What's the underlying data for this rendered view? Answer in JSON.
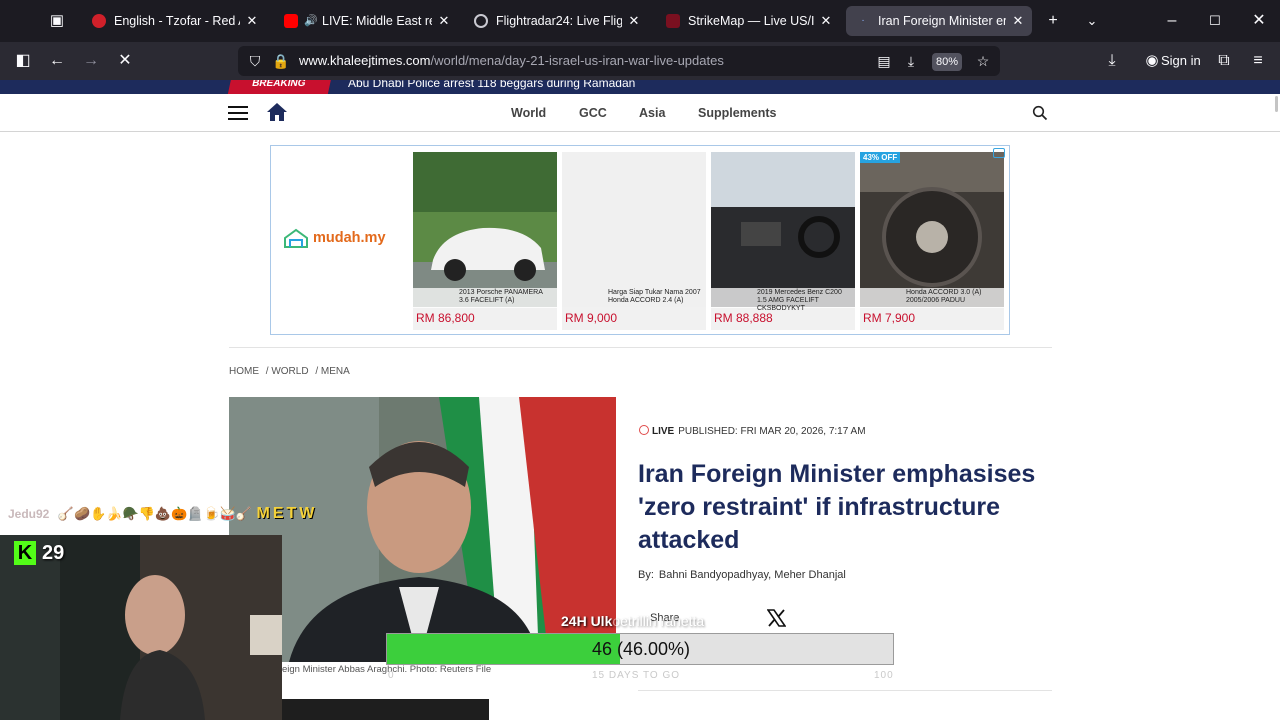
{
  "browser": {
    "tabs": [
      {
        "label": "English - Tzofar - Red Alert",
        "active": false
      },
      {
        "label": "LIVE: Middle East real-ti",
        "active": false
      },
      {
        "label": "Flightradar24: Live Flight Tr",
        "active": false
      },
      {
        "label": "StrikeMap — Live US/Israel",
        "active": false
      },
      {
        "label": "Iran Foreign Minister empha",
        "active": true
      }
    ],
    "url_domain": "www.khaleejtimes.com",
    "url_path": "/world/mena/day-21-israel-us-iran-war-live-updates",
    "zoom": "80%",
    "sign_in_label": "Sign in"
  },
  "site": {
    "breaking_badge": "BREAKING",
    "breaking_text": "Abu Dhabi Police arrest 118 beggars during Ramadan",
    "nav": [
      "World",
      "GCC",
      "Asia",
      "Supplements"
    ]
  },
  "ad": {
    "brand": "mudah.my",
    "cards": [
      {
        "caption": "2013 Porsche PANAMERA 3.6 FACELIFT (A)",
        "price": "RM 86,800",
        "badge": ""
      },
      {
        "caption": "Harga Siap Tukar Nama 2007 Honda ACCORD 2.4 (A)",
        "price": "RM 9,000",
        "badge": ""
      },
      {
        "caption": "2019 Mercedes Benz C200 1.5 AMG FACELIFT CKSBODYKYT",
        "price": "RM 88,888",
        "badge": ""
      },
      {
        "caption": "Honda ACCORD 3.0 (A) 2005/2006 PADUU",
        "price": "RM 7,900",
        "badge": "43% OFF"
      }
    ]
  },
  "article": {
    "breadcrumb": [
      "HOME",
      "/ WORLD",
      "/ MENA"
    ],
    "live_label": "LIVE",
    "published": "PUBLISHED: FRI MAR 20, 2026, 7:17 AM",
    "headline": "Iran Foreign Minister emphasises 'zero restraint' if infrastructure attacked",
    "by_label": "By:",
    "authors": "Bahni Bandyopadhyay, Meher Dhanjal",
    "share_label": "Share",
    "photo_caption": "eign Minister Abbas Araghchi. Photo: Reuters File"
  },
  "stream": {
    "chat_user": "Jedu92",
    "chat_emotes": "🪕🥔✋🍌🪖👎💩🎃🪦🍺🥁🪕",
    "chat_message": "METW",
    "kick_viewers": "29",
    "goal_title": "24H Ulk",
    "goal_title_faded": "oetrillin rahetta",
    "goal_current": 46,
    "goal_target": 100,
    "goal_fraction": 0.46,
    "goal_text": "46 (46.00%)",
    "goal_min": "0",
    "goal_days": "15 DAYS TO GO",
    "goal_max": "100"
  },
  "colors": {
    "brand_navy": "#1d2b5c",
    "breaking_red": "#c8102e",
    "goal_green": "#3ccf3c",
    "kick_green": "#53fc18"
  }
}
